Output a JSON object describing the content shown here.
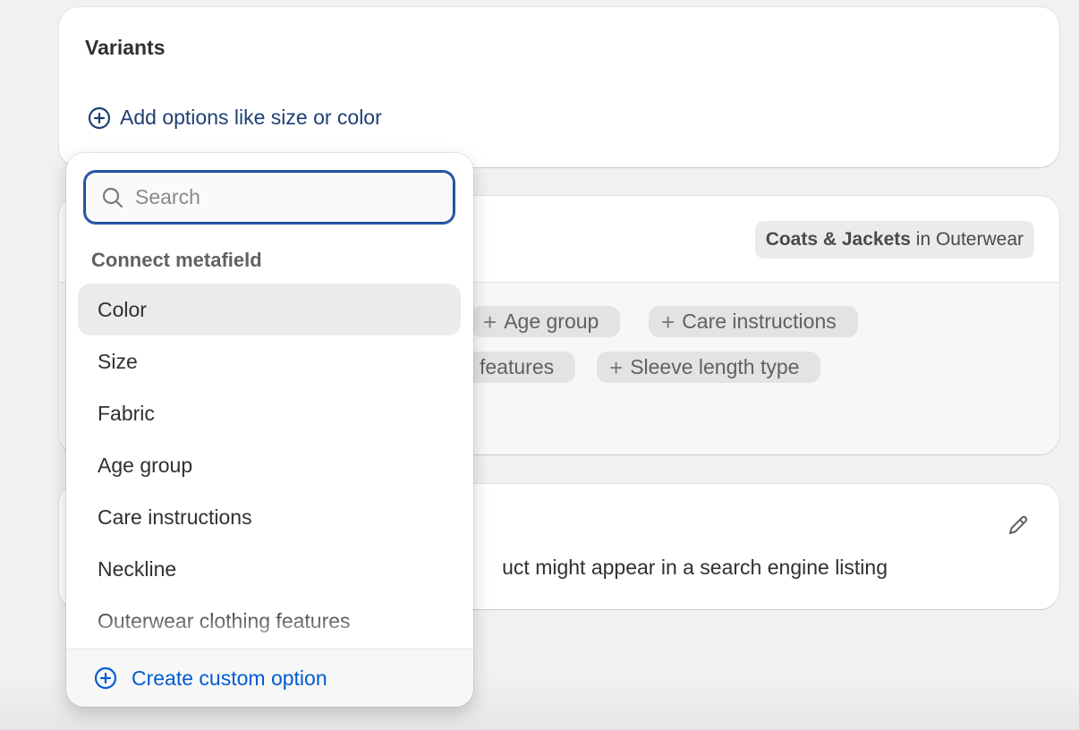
{
  "variants": {
    "title": "Variants",
    "add_options_label": "Add options like size or color"
  },
  "category": {
    "badge_name": "Coats & Jackets",
    "badge_suffix": "in Outerwear",
    "chips": [
      "Age group",
      "Care instructions",
      "features",
      "Sleeve length type"
    ]
  },
  "seo": {
    "preview_text": "uct might appear in a search engine listing"
  },
  "popover": {
    "search_placeholder": "Search",
    "section_title": "Connect metafield",
    "options": [
      "Color",
      "Size",
      "Fabric",
      "Age group",
      "Care instructions",
      "Neckline",
      "Outerwear clothing features"
    ],
    "active_option": "Color",
    "footer_label": "Create custom option"
  },
  "colors": {
    "link_dark": "#1f3f73",
    "link_blue": "#005bd3",
    "focus_ring": "#2a5aa8"
  }
}
